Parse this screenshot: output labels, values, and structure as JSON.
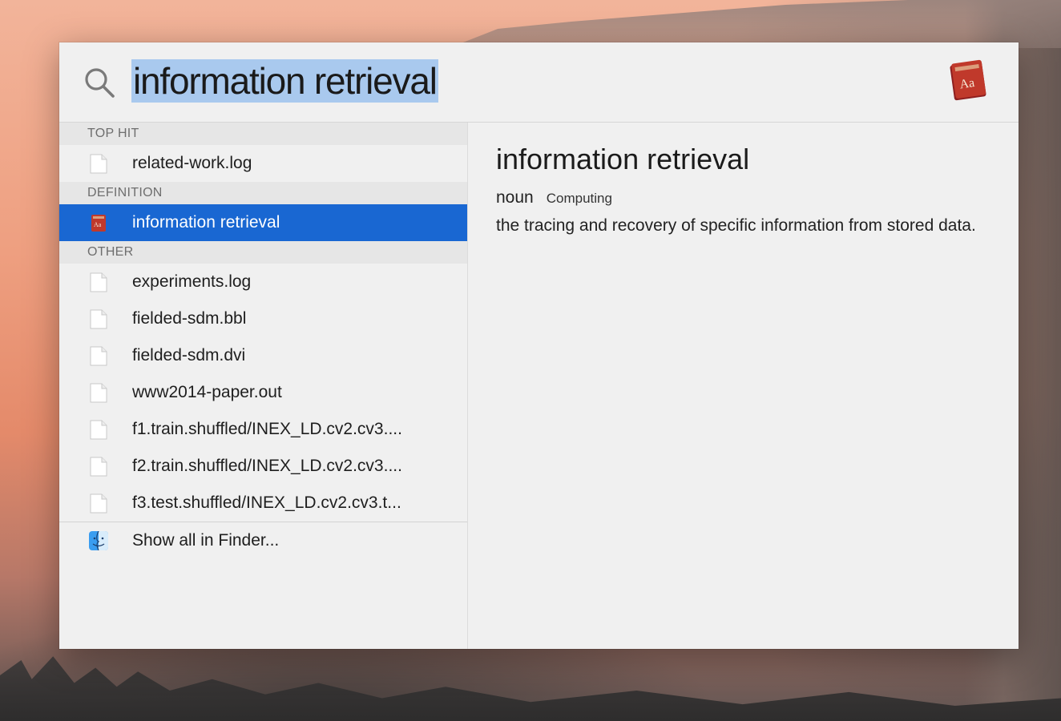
{
  "search": {
    "query": "information retrieval",
    "app_icon": "dictionary-icon"
  },
  "results": {
    "top_hit_header": "TOP HIT",
    "top_hit": {
      "label": "related-work.log",
      "icon": "document-icon"
    },
    "definition_header": "DEFINITION",
    "definition_item": {
      "label": "information retrieval",
      "icon": "dictionary-icon"
    },
    "other_header": "OTHER",
    "other": [
      {
        "label": "experiments.log",
        "icon": "document-icon"
      },
      {
        "label": "fielded-sdm.bbl",
        "icon": "document-icon"
      },
      {
        "label": "fielded-sdm.dvi",
        "icon": "document-icon"
      },
      {
        "label": "www2014-paper.out",
        "icon": "document-icon"
      },
      {
        "label": "f1.train.shuffled/INEX_LD.cv2.cv3....",
        "icon": "document-icon"
      },
      {
        "label": "f2.train.shuffled/INEX_LD.cv2.cv3....",
        "icon": "document-icon"
      },
      {
        "label": "f3.test.shuffled/INEX_LD.cv2.cv3.t...",
        "icon": "document-icon"
      }
    ],
    "show_all": {
      "label": "Show all in Finder...",
      "icon": "finder-icon"
    }
  },
  "preview": {
    "title": "information retrieval",
    "part_of_speech": "noun",
    "domain": "Computing",
    "definition": "the tracing and recovery of specific information from stored data."
  },
  "colors": {
    "selection": "#1967d2",
    "query_highlight": "#a9c9ee",
    "panel": "#f0f0f0"
  }
}
